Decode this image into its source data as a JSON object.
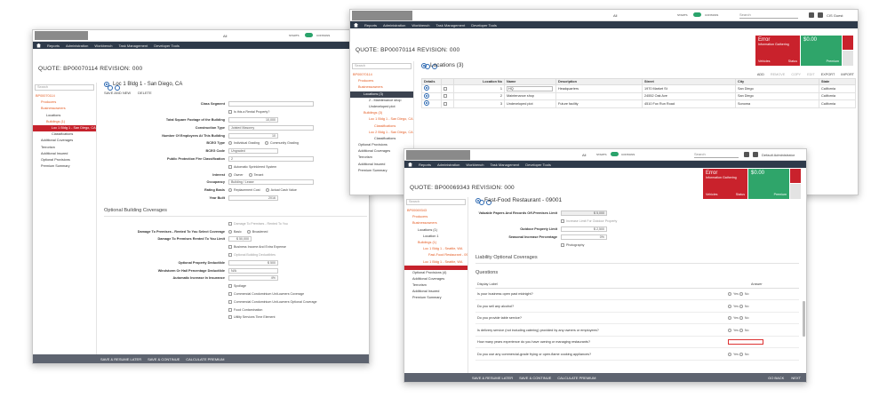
{
  "colors": {
    "nav": "#2e3a4a",
    "accent": "#e45b22",
    "selected": "#3c4350",
    "error": "#c9222c",
    "success": "#2fa56a",
    "footer": "#5e6470",
    "link": "#2a67b1"
  },
  "common": {
    "topbar": {
      "scope_select": "All",
      "toggle_left": "STARTS",
      "toggle_right": "CONTAINS",
      "search_placeholder": "Search",
      "user_left": "CIS Guest",
      "user_right": "Default Administrator"
    },
    "nav": [
      "Reports",
      "Administration",
      "Workbench",
      "Task Management",
      "Developer Tools"
    ],
    "alerts": {
      "error_title": "Error",
      "error_sub": "Information Gathering",
      "error_left": "Vehicles",
      "error_right": "Status",
      "money": "$0.00",
      "money_right": "Premium"
    },
    "footer": {
      "save_resume": "SAVE & RESUME LATER",
      "save_continue": "SAVE & CONTINUE",
      "calc": "CALCULATE PREMIUM",
      "back": "GO BACK",
      "next": "NEXT"
    }
  },
  "win1": {
    "quote": "QUOTE:  BP00070114  REVISION:  000",
    "search_placeholder": "Search",
    "tree": [
      "BP00070114",
      "Producers",
      "Businessowners",
      "Locations",
      "Buildings (1)",
      "Loc 1 Bldg 1 - San Diego, CA",
      "Classifications",
      "Additional Coverages",
      "Terrorism",
      "Additional Insured",
      "Optional Provisions",
      "Premium Summary"
    ],
    "title": "Loc 1 Bldg 1 - San Diego, CA",
    "actions": {
      "save_new": "SAVE AND NEW",
      "delete": "DELETE"
    },
    "fields": {
      "class_segment": "Class Segment",
      "rental": "Is this a Rental Property?",
      "sq_footage": "Total Square Footage of the Building",
      "sq_footage_val": "10,000",
      "construction": "Construction Type",
      "construction_val": "Joisted Masonry",
      "employees": "Number Of Employees At This Building",
      "employees_val": "10",
      "bceg_type": "BCEG Type",
      "bceg_opt1": "Individual Grading",
      "bceg_opt2": "Community Grading",
      "bceg_code": "BCEG Code",
      "bceg_code_val": "Ungraded",
      "ppc": "Public Protection Fire Classification",
      "ppc_val": "2",
      "sprinkler": "Automatic Sprinklered System",
      "interest": "Interest",
      "interest_opt1": "Owner",
      "interest_opt2": "Tenant",
      "occupancy": "Occupancy",
      "occupancy_val": "Building / Lease",
      "rating": "Rating Basis",
      "rating_opt1": "Replacement Cost",
      "rating_opt2": "Actual Cash Value",
      "year": "Year Built",
      "year_val": "2016"
    },
    "obc_title": "Optional Building Coverages",
    "obc": {
      "dmg_chk": "Damage To Premises - Rented To You",
      "dmg_sel": "Damage To Premises - Rented To You Select Coverage",
      "dmg_opt1": "Basic",
      "dmg_opt2": "Broadened",
      "dmg_limit": "Damage To Premises Rented To You Limit",
      "dmg_limit_val": "$ 50,000",
      "bi": "Business Income And Extra Expense",
      "obd": "Optional Building Deductibles",
      "opd": "Optional Property Deductible",
      "opd_val": "$ 500",
      "wind": "Windstorm Or Hail Percentage Deductible",
      "wind_val": "N/A",
      "auto_inc": "Automatic Increase In Insurance",
      "auto_inc_val": "4%",
      "list": [
        "Spoilage",
        "Commercial Condominium Unit-owners Coverage",
        "Commercial Condominium Unit-owners Optional Coverage",
        "Food Contamination",
        "Utility Services Time Element"
      ]
    }
  },
  "win2": {
    "quote": "QUOTE:  BP00070114  REVISION:  000",
    "search_placeholder": "Search",
    "tree": [
      "BP00070114",
      "Producers",
      "Businessowners",
      "Locations (3)",
      "2 - Maintenance shop",
      "Undeveloped plot",
      "Buildings (3)",
      "Loc 1 Bldg 1 - San Diego, CA",
      "Classifications",
      "Loc 2 Bldg 1 - San Diego, CA",
      "Classifications",
      "Optional Provisions",
      "Additional Coverages",
      "Terrorism",
      "Additional Insured",
      "Premium Summary"
    ],
    "title": "Locations (3)",
    "tools": [
      "ADD",
      "REMOVE",
      "COPY",
      "EDIT",
      "EXPORT",
      "IMPORT"
    ],
    "headers": [
      "Details",
      "",
      "Location No",
      "Name",
      "Description",
      "Street",
      "City",
      "State"
    ],
    "rows": [
      [
        "1",
        "HQ",
        "Headquarters",
        "1970 Market St",
        "San Diego",
        "California"
      ],
      [
        "2",
        "Maintenance shop",
        "",
        "24552 Oak Ave",
        "San Diego",
        "California"
      ],
      [
        "3",
        "Undeveloped plot",
        "Future facility",
        "4510 Fox Run Road",
        "Sonoma",
        "California"
      ]
    ]
  },
  "win3": {
    "quote": "QUOTE:  BP00069343  REVISION:  000",
    "search_placeholder": "Search",
    "tree": [
      "BP00069343",
      "Producers",
      "Businessowners",
      "Locations (1)",
      "Location 1",
      "Buildings (1)",
      "Loc 1 Bldg 1 - Seattle, WA",
      "Fast-Food Restaurant - 09001",
      "Loc 1 Bldg 1 - Seattle, WA",
      "Optional Provisions (4)",
      "Additional Coverages",
      "Terrorism",
      "Additional Insured",
      "Premium Summary"
    ],
    "title": "Fast-Food Restaurant - 09001",
    "fields": {
      "valuable": "Valuable Papers And Records Off-Premises Limit",
      "valuable_val": "$ 5,000",
      "increase_chk": "Increase Limit For Outdoor Property",
      "outdoor": "Outdoor Property Limit",
      "outdoor_val": "$ 2,500",
      "seasonal": "Seasonal Increase Percentage",
      "seasonal_val": "0%",
      "photo": "Photography"
    },
    "lob_title": "Liability Optional Coverages",
    "q_title": "Questions",
    "q_head_label": "Display Label",
    "q_head_answer": "Answer",
    "yes": "Yes",
    "no": "No",
    "questions": [
      "Is your business open past midnight?",
      "Do you sell any alcohol?",
      "Do you provide table service?",
      "Is delivery service (not including catering) provided by any owners or employees?",
      "How many years experience do you have owning or managing restaurants?",
      "Do you use any commercial-grade frying or open-flame cooking appliances?"
    ]
  }
}
